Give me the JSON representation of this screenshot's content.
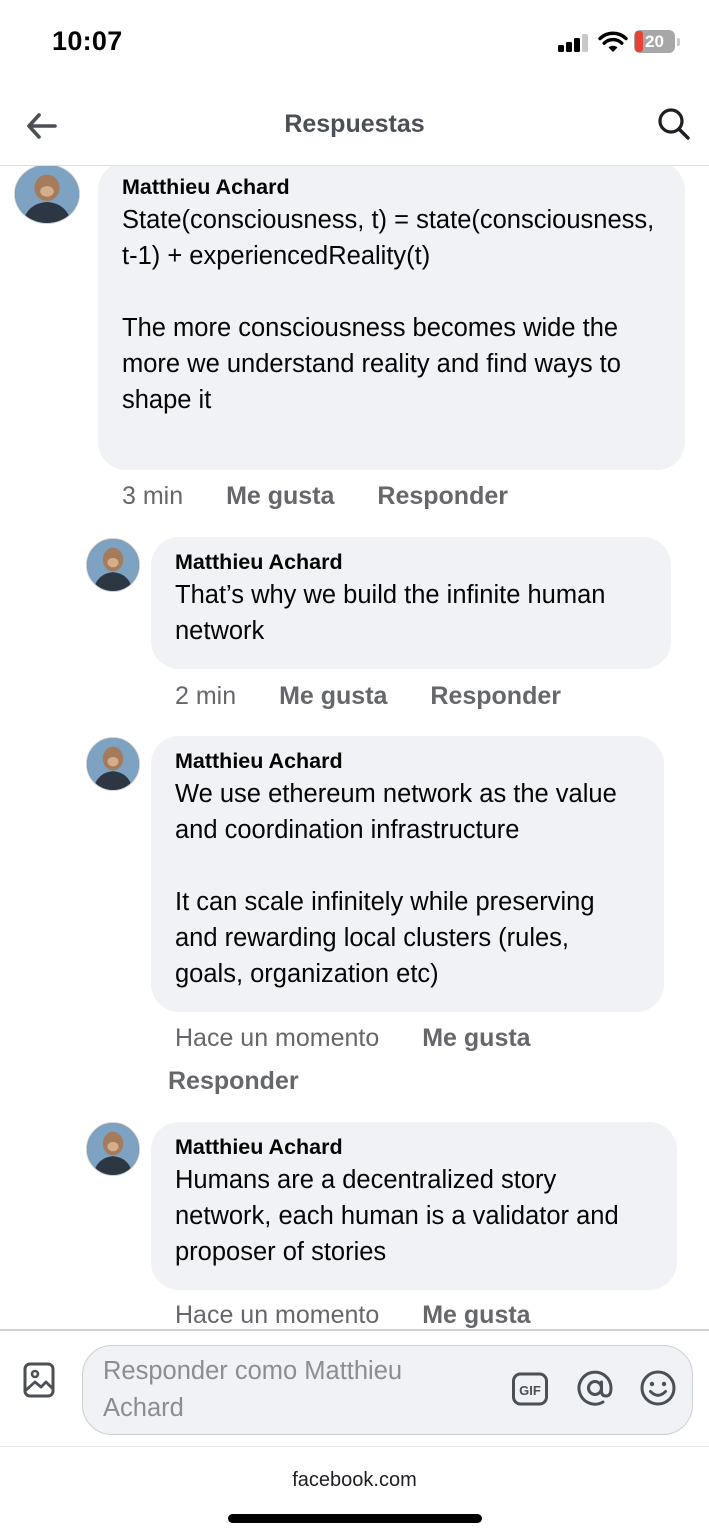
{
  "status_bar": {
    "time": "10:07",
    "battery": "20"
  },
  "header": {
    "title": "Respuestas"
  },
  "comments": [
    {
      "author": "Matthieu Achard",
      "paragraphs": [
        "State(consciousness, t) = state(consciousness, t-1) + experiencedReality(t)",
        "The more consciousness becomes wide the more we understand reality and find ways to shape it"
      ],
      "time": "3 min",
      "like": "Me gusta",
      "reply": "Responder"
    },
    {
      "author": "Matthieu Achard",
      "paragraphs": [
        "That’s why we build the infinite human network"
      ],
      "time": "2 min",
      "like": "Me gusta",
      "reply": "Responder"
    },
    {
      "author": "Matthieu Achard",
      "paragraphs": [
        "We use ethereum network as the value and coordination infrastructure",
        "It can scale infinitely while preserving and rewarding local clusters (rules, goals, organization etc)"
      ],
      "time": "Hace un momento",
      "like": "Me gusta",
      "reply": "Responder"
    },
    {
      "author": "Matthieu Achard",
      "paragraphs": [
        "Humans are a decentralized story network, each human is a validator and proposer of stories"
      ],
      "time": "Hace un momento",
      "like": "Me gusta"
    }
  ],
  "composer": {
    "placeholder": "Responder como Matthieu Achard"
  },
  "footer": {
    "url": "facebook.com"
  },
  "icons": {
    "back": "arrow-left-icon",
    "search": "search-icon",
    "photo": "photo-icon",
    "gif": "gif-icon",
    "mention": "at-sign-icon",
    "emoji": "smiley-icon"
  },
  "colors": {
    "bubble": "#f0f2f5",
    "meta_text": "#65676b",
    "header_title": "#4b4f56",
    "battery_low": "#eb3b2f"
  }
}
